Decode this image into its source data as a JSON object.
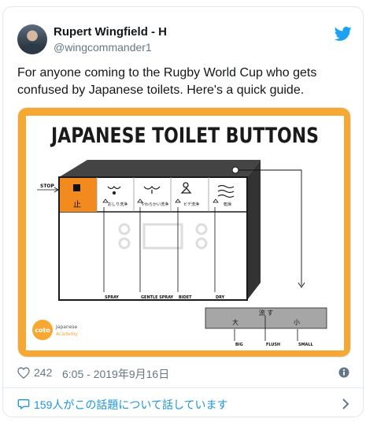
{
  "author": {
    "name": "Rupert Wingfield - H",
    "handle": "@wingcommander1"
  },
  "tweet": {
    "text_line1": "For anyone coming to the Rugby World Cup who gets",
    "text_line2": "confused by Japanese toilets.  Here's a quick guide."
  },
  "infographic": {
    "title": "JAPANESE TOILET BUTTONS",
    "stop_label": "STOP",
    "stop_kanji": "止",
    "button_captions": [
      "おしり\n洗浄",
      "やわらかい\n洗浄",
      "ビデ\n洗浄",
      "乾燥"
    ],
    "function_labels": [
      "SPRAY",
      "GENTLE SPRAY",
      "BIDET",
      "DRY"
    ],
    "flush_top": "流 す",
    "flush_big": "大",
    "flush_small": "小",
    "flush_labels": [
      "BIG",
      "FLUSH",
      "SMALL"
    ],
    "logo_text": "coto",
    "logo_sub1": "Japanese",
    "logo_sub2": "Academy",
    "accent_color": "#f7a833",
    "orange_color": "#f28a1e"
  },
  "stats": {
    "likes": "242",
    "timestamp": "6:05 - 2019年9月16日"
  },
  "reply": {
    "text": "159人がこの話題について話しています"
  },
  "icons": [
    "twitter-bird-icon",
    "heart-icon",
    "info-icon",
    "comment-icon",
    "chevron-right-icon"
  ],
  "colors": {
    "link": "#1b95e0",
    "muted": "#657786",
    "twitter_blue": "#1da1f2"
  }
}
